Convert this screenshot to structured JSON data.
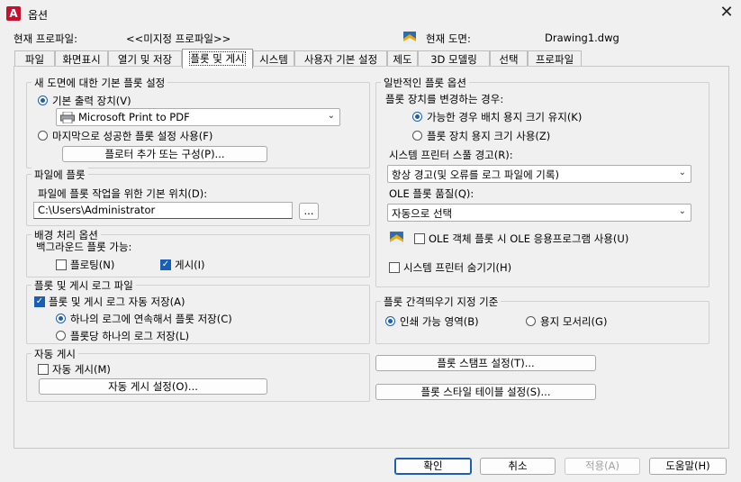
{
  "window": {
    "title": "옵션",
    "app_icon_letter": "A",
    "close_glyph": "✕"
  },
  "header": {
    "profile_label": "현재 프로파일:",
    "profile_value": "<<미지정 프로파일>>",
    "drawing_label": "현재 도면:",
    "drawing_value": "Drawing1.dwg"
  },
  "tabs": [
    "파일",
    "화면표시",
    "열기 및 저장",
    "플롯 및 게시",
    "시스템",
    "사용자 기본 설정",
    "제도",
    "3D 모델링",
    "선택",
    "프로파일"
  ],
  "active_tab": "플롯 및 게시",
  "new_drawing": {
    "title": "새 도면에 대한 기본 플롯 설정",
    "default_device_label": "기본 출력 장치(V)",
    "device_value": "Microsoft Print to PDF",
    "last_successful_label": "마지막으로 성공한 플롯 설정 사용(F)",
    "add_plotter_button": "플로터 추가 또는 구성(P)..."
  },
  "plot_to_file": {
    "title": "파일에 플롯",
    "location_label": "파일에 플롯 작업을 위한 기본 위치(D):",
    "location_value": "C:\\Users\\Administrator",
    "browse_button": "..."
  },
  "background": {
    "title": "배경 처리 옵션",
    "enable_label": "백그라운드 플롯 가능:",
    "plotting_label": "플로팅(N)",
    "publishing_label": "게시(I)",
    "plotting_checked": false,
    "publishing_checked": true
  },
  "log": {
    "title": "플롯 및 게시 로그 파일",
    "auto_save_label": "플롯 및 게시 로그 자동 저장(A)",
    "continuous_label": "하나의 로그에 연속해서 플롯 저장(C)",
    "per_plot_label": "플롯당 하나의 로그 저장(L)"
  },
  "auto_publish": {
    "title": "자동 게시",
    "checkbox_label": "자동 게시(M)",
    "settings_button": "자동 게시 설정(O)..."
  },
  "general": {
    "title": "일반적인 플롯 옵션",
    "change_device_label": "플롯 장치를 변경하는 경우:",
    "keep_layout_label": "가능한 경우 배치 용지 크기 유지(K)",
    "use_device_paper_label": "플롯 장치 용지 크기 사용(Z)",
    "spool_alert_label": "시스템 프린터 스풀 경고(R):",
    "spool_alert_value": "항상 경고(및 오류를 로그 파일에 기록)",
    "ole_quality_label": "OLE 플롯 품질(Q):",
    "ole_quality_value": "자동으로 선택",
    "ole_app_label": "OLE 객체 플롯 시 OLE 응용프로그램 사용(U)",
    "hide_printers_label": "시스템 프린터 숨기기(H)"
  },
  "offset": {
    "title": "플롯 간격띄우기 지정 기준",
    "printable_label": "인쇄 가능 영역(B)",
    "paper_edge_label": "용지 모서리(G)"
  },
  "side_buttons": {
    "stamp": "플롯 스탬프 설정(T)...",
    "style_table": "플롯 스타일 테이블 설정(S)..."
  },
  "footer": {
    "ok": "확인",
    "cancel": "취소",
    "apply": "적용(A)",
    "help": "도움말(H)"
  },
  "colors": {
    "accent": "#1a5fb4",
    "app_icon": "#c8102e"
  }
}
